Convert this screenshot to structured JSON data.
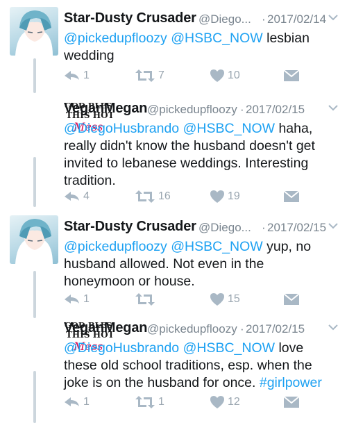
{
  "tweets": [
    {
      "display_name": "Star-Dusty Crusader",
      "handle": "@Diego...",
      "date": "2017/02/14",
      "segments": [
        {
          "text": "@pickedupfloozy",
          "type": "mention"
        },
        {
          "text": " ",
          "type": "plain"
        },
        {
          "text": "@HSBC_NOW",
          "type": "mention"
        },
        {
          "text": " lesbian wedding",
          "type": "plain"
        }
      ],
      "reply_count": "1",
      "retweet_count": "7",
      "like_count": "10"
    },
    {
      "display_name": "VeganMegan",
      "handle": "@pickedupfloozy",
      "date": "2017/02/15",
      "avatar_text": [
        "GOD BLESS",
        "THIS HOT",
        "Mess"
      ],
      "segments": [
        {
          "text": "@DiegoHusbrando",
          "type": "mention"
        },
        {
          "text": " ",
          "type": "plain"
        },
        {
          "text": "@HSBC_NOW",
          "type": "mention"
        },
        {
          "text": " haha, really didn't know the husband doesn't get invited to lebanese weddings. Interesting tradition.",
          "type": "plain"
        }
      ],
      "reply_count": "4",
      "retweet_count": "16",
      "like_count": "19"
    },
    {
      "display_name": "Star-Dusty Crusader",
      "handle": "@Diego...",
      "date": "2017/02/15",
      "segments": [
        {
          "text": "@pickedupfloozy",
          "type": "mention"
        },
        {
          "text": " ",
          "type": "plain"
        },
        {
          "text": "@HSBC_NOW",
          "type": "mention"
        },
        {
          "text": " yup, no husband allowed. Not even in the honeymoon or house.",
          "type": "plain"
        }
      ],
      "reply_count": "1",
      "retweet_count": "",
      "like_count": "15"
    },
    {
      "display_name": "VeganMegan",
      "handle": "@pickedupfloozy",
      "date": "2017/02/15",
      "avatar_text": [
        "GOD BLESS",
        "THIS HOT",
        "Mess"
      ],
      "segments": [
        {
          "text": "@DiegoHusbrando",
          "type": "mention"
        },
        {
          "text": " ",
          "type": "plain"
        },
        {
          "text": "@HSBC_NOW",
          "type": "mention"
        },
        {
          "text": " love these old school traditions, esp. when the joke is on the husband for once. ",
          "type": "plain"
        },
        {
          "text": "#girlpower",
          "type": "hashtag"
        }
      ],
      "reply_count": "1",
      "retweet_count": "1",
      "like_count": "12"
    }
  ],
  "separator": "·",
  "colors": {
    "link": "#1da1f2",
    "meta": "#7a858f",
    "icon": "#a9b8c5",
    "thread_line": "#ccd6dd"
  },
  "icons": [
    "reply-icon",
    "retweet-icon",
    "like-icon",
    "direct-message-icon",
    "chevron-down-icon"
  ]
}
